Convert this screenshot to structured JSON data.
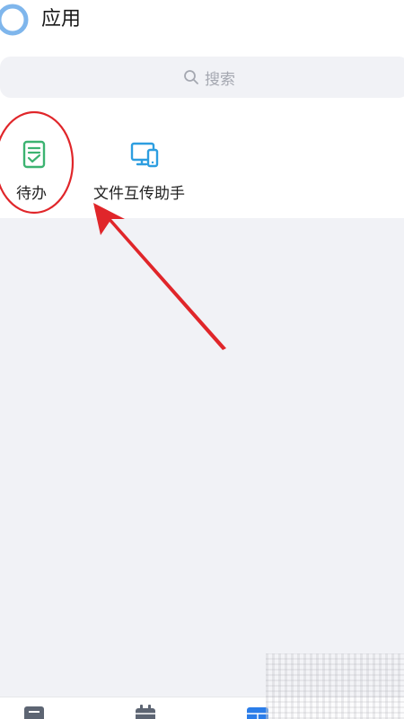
{
  "header": {
    "title": "应用",
    "avatar_icon": "user-avatar-icon"
  },
  "search": {
    "placeholder": "搜索",
    "icon": "search-icon"
  },
  "apps": [
    {
      "label": "待办",
      "icon": "todo-checklist-icon",
      "color": "#3cb371",
      "highlighted": true
    },
    {
      "label": "文件互传助手",
      "icon": "file-transfer-devices-icon",
      "color": "#2d9ee0"
    }
  ],
  "bottom_nav": [
    {
      "icon": "docs-icon"
    },
    {
      "icon": "calendar-icon"
    },
    {
      "icon": "apps-icon",
      "active": true
    }
  ],
  "colors": {
    "annotation_red": "#e0262a",
    "page_background": "#f1f2f6",
    "active_blue": "#2b7de9"
  }
}
